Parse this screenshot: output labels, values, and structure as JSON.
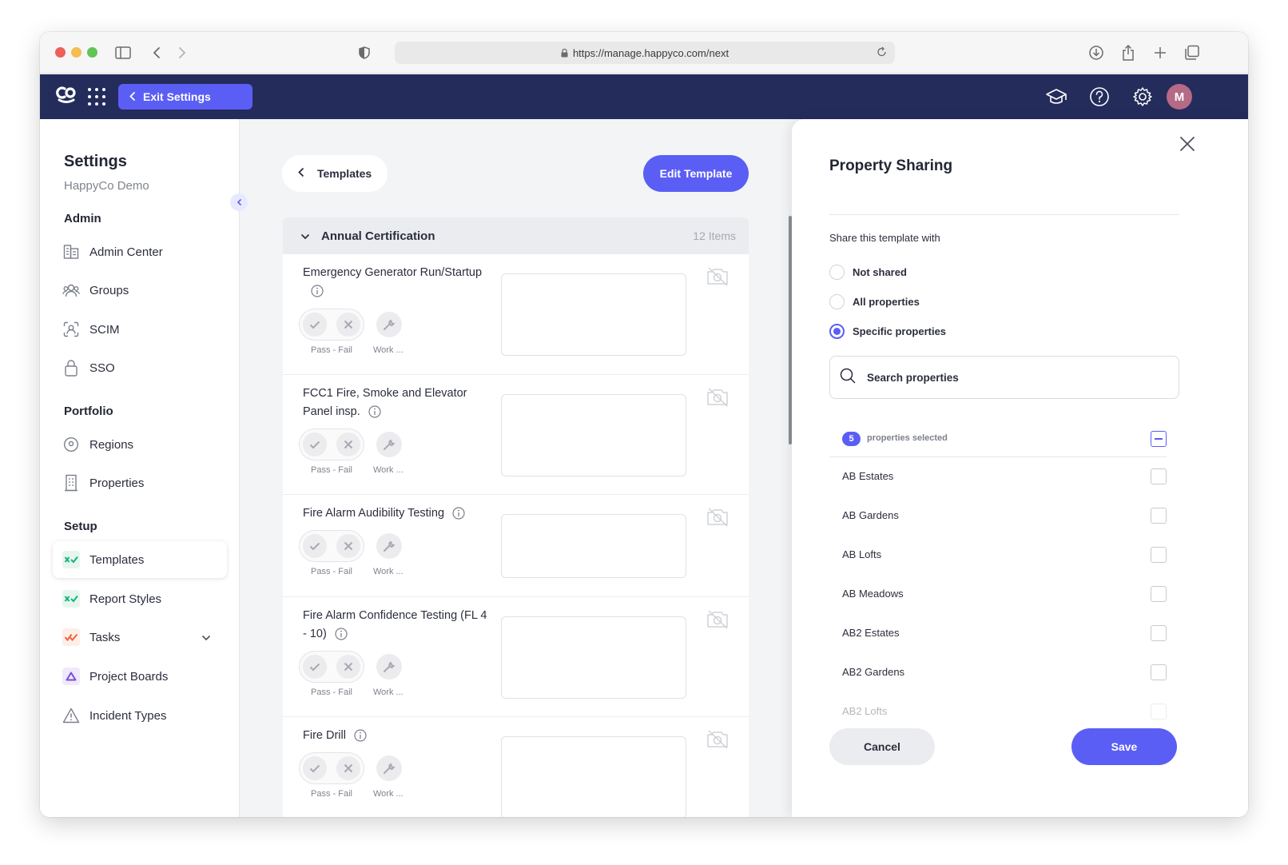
{
  "browser": {
    "url": "https://manage.happyco.com/next"
  },
  "appbar": {
    "exit_label": "Exit Settings",
    "avatar_initial": "M"
  },
  "sidebar": {
    "title": "Settings",
    "subtitle": "HappyCo Demo",
    "sections": {
      "admin": "Admin",
      "portfolio": "Portfolio",
      "setup": "Setup"
    },
    "items": {
      "admin_center": "Admin Center",
      "groups": "Groups",
      "scim": "SCIM",
      "sso": "SSO",
      "regions": "Regions",
      "properties": "Properties",
      "templates": "Templates",
      "report_styles": "Report Styles",
      "tasks": "Tasks",
      "project_boards": "Project Boards",
      "incident_types": "Incident Types"
    }
  },
  "main": {
    "back_label": "Templates",
    "edit_label": "Edit Template",
    "section_title": "Annual Certification",
    "section_count": "12 Items",
    "pass_fail_label": "Pass - Fail",
    "work_label": "Work ...",
    "items": [
      {
        "title": "Emergency Generator Run/Startup"
      },
      {
        "title": "FCC1 Fire, Smoke and Elevator Panel insp."
      },
      {
        "title": "Fire Alarm Audibility Testing"
      },
      {
        "title": "Fire Alarm Confidence Testing (FL 4 - 10)"
      },
      {
        "title": "Fire Drill"
      }
    ]
  },
  "panel": {
    "title": "Property Sharing",
    "share_label": "Share this template with",
    "options": {
      "not_shared": "Not shared",
      "all": "All properties",
      "specific": "Specific properties"
    },
    "selected_option": "specific",
    "search_placeholder": "Search properties",
    "selected_count": "5",
    "selected_text": "properties selected",
    "properties": [
      "AB Estates",
      "AB Gardens",
      "AB Lofts",
      "AB Meadows",
      "AB2 Estates",
      "AB2 Gardens",
      "AB2 Lofts"
    ],
    "cancel_label": "Cancel",
    "save_label": "Save"
  },
  "colors": {
    "accent": "#5b5ef4",
    "header": "#242c5c"
  }
}
